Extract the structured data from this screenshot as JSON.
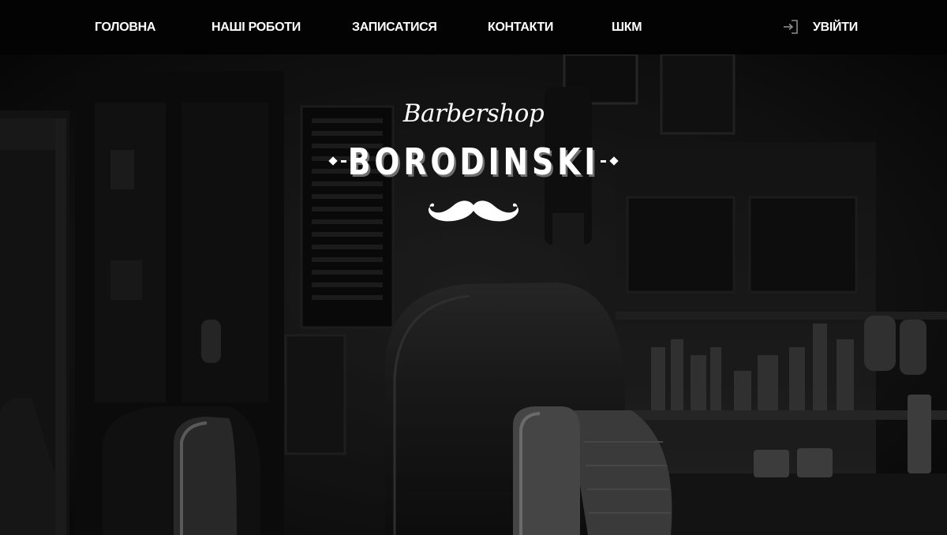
{
  "nav": {
    "home": "ГОЛОВНА",
    "works": "НАШІ РОБОТИ",
    "book": "ЗАПИСАТИСЯ",
    "contacts": "КОНТАКТИ",
    "shkm": "ШКМ",
    "login": "УВІЙТИ",
    "login_icon": "sign-in-icon"
  },
  "logo": {
    "script": "Barbershop",
    "name": "BORODINSKI",
    "mustache_icon": "mustache-icon"
  },
  "colors": {
    "topbar": "#030303",
    "text": "#ffffff",
    "background": "#0d0d0d",
    "logo_shadow": "#6f6f6f"
  }
}
